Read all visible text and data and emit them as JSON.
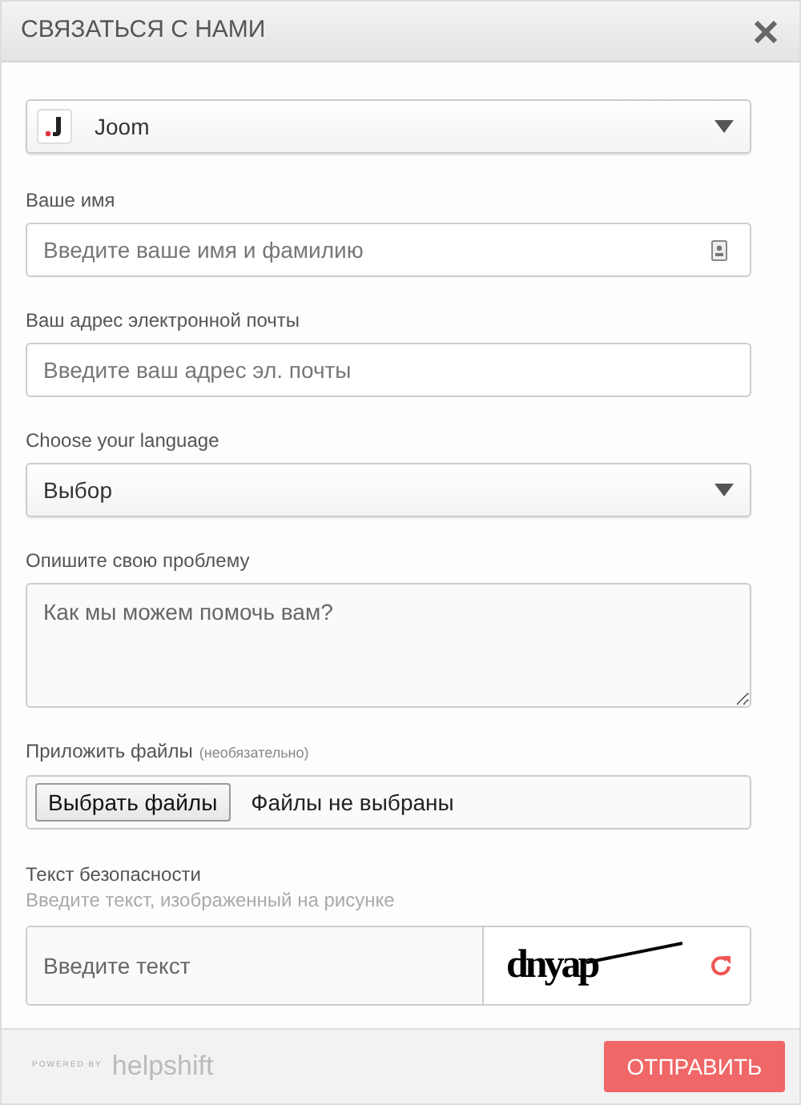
{
  "window": {
    "title": "СВЯЗАТЬСЯ С НАМИ"
  },
  "app_select": {
    "value": "Joom"
  },
  "fields": [
    {
      "kind": "text",
      "label": "Ваше имя",
      "placeholder": "Введите ваше имя и фамилию",
      "contact_icon": true
    },
    {
      "kind": "text",
      "label": "Ваш адрес электронной почты",
      "placeholder": "Введите ваш адрес эл. почты",
      "contact_icon": false
    },
    {
      "kind": "select",
      "label": "Choose your language",
      "value": "Выбор"
    },
    {
      "kind": "textarea",
      "label": "Опишите свою проблему",
      "placeholder": "Как мы можем помочь вам?"
    }
  ],
  "attachments": {
    "label": "Приложить файлы",
    "optional": "(необязательно)",
    "button": "Выбрать файлы",
    "status": "Файлы не выбраны"
  },
  "captcha": {
    "label": "Текст безопасности",
    "hint": "Введите текст, изображенный на рисунке",
    "placeholder": "Введите текст",
    "image_text": "dnyap"
  },
  "footer": {
    "powered_by": "POWERED BY",
    "brand": "helpshift",
    "submit": "ОТПРАВИТЬ"
  }
}
